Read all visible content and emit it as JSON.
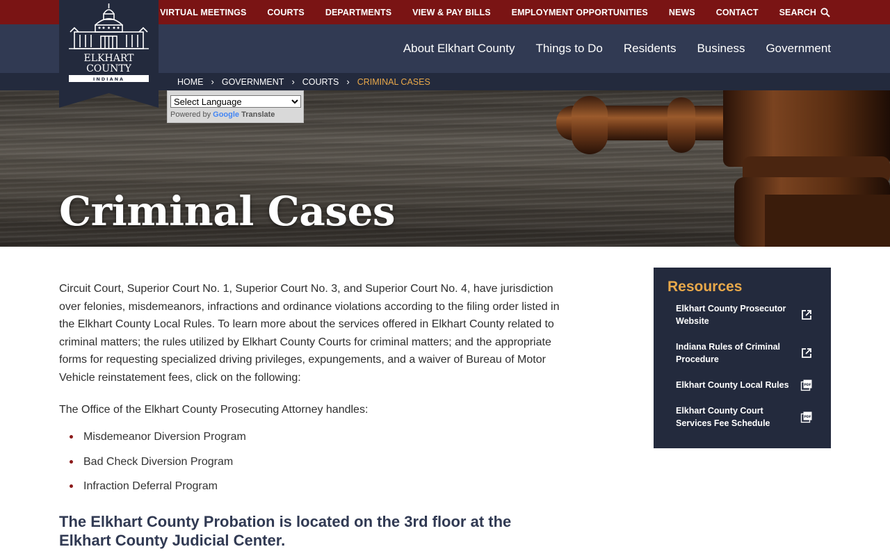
{
  "topbar": {
    "links": [
      "VIRTUAL MEETINGS",
      "COURTS",
      "DEPARTMENTS",
      "VIEW & PAY BILLS",
      "EMPLOYMENT OPPORTUNITIES",
      "NEWS",
      "CONTACT"
    ],
    "search_label": "SEARCH"
  },
  "logo": {
    "line1": "ELKHART",
    "line2": "COUNTY",
    "line3": "INDIANA"
  },
  "mainnav": {
    "links": [
      "About Elkhart County",
      "Things to Do",
      "Residents",
      "Business",
      "Government"
    ]
  },
  "breadcrumb": {
    "items": [
      "HOME",
      "GOVERNMENT",
      "COURTS"
    ],
    "current": "CRIMINAL CASES"
  },
  "translate": {
    "select_value": "Select Language",
    "powered_by": "Powered by",
    "google": "Google",
    "translate_word": "Translate"
  },
  "hero": {
    "title": "Criminal Cases"
  },
  "content": {
    "intro": "Circuit Court, Superior Court No. 1, Superior Court No. 3, and Superior Court No. 4, have jurisdiction over felonies, misdemeanors, infractions and ordinance violations according to the filing order listed in the Elkhart County Local Rules. To learn more about the services offered in Elkhart County related to criminal matters; the rules utilized by Elkhart County Courts for criminal matters; and the appropriate forms for requesting specialized driving privileges, expungements, and a waiver of Bureau of Motor Vehicle reinstatement fees, click on the following:",
    "prosecutor_text": "The Office of the Elkhart County Prosecuting Attorney handles:",
    "programs": [
      "Misdemeanor Diversion Program",
      "Bad Check Diversion Program",
      "Infraction Deferral Program"
    ],
    "probation_heading": "The Elkhart County Probation is located on the 3rd floor at the Elkhart County Judicial Center."
  },
  "resources": {
    "title": "Resources",
    "items": [
      {
        "label": "Elkhart County Prosecutor Website",
        "icon": "external-link-icon"
      },
      {
        "label": "Indiana Rules of Criminal Procedure",
        "icon": "external-link-icon"
      },
      {
        "label": "Elkhart County Local Rules",
        "icon": "pdf-icon"
      },
      {
        "label": "Elkhart County Court Services Fee Schedule",
        "icon": "pdf-icon"
      }
    ]
  },
  "colors": {
    "topbar": "#7a1414",
    "mainnav": "#313a53",
    "crumbbar": "#232a3d",
    "accent": "#e8a84a"
  }
}
